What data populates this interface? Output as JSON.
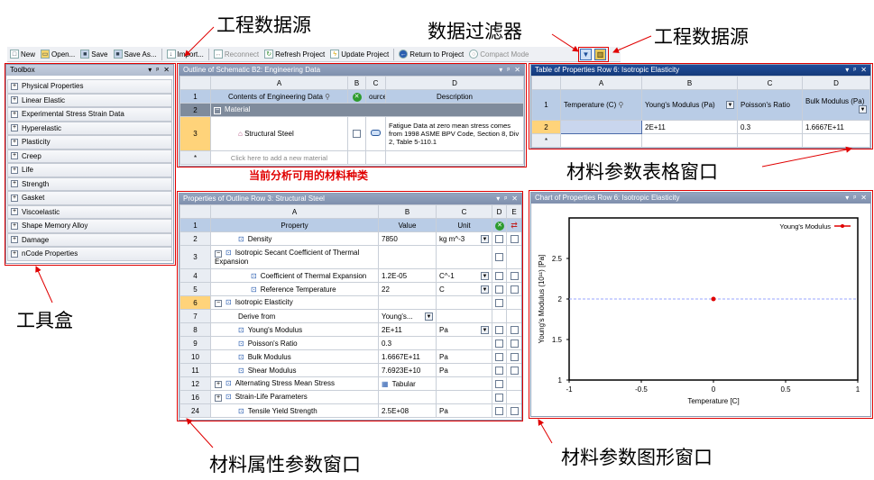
{
  "annotations": {
    "engineering_data_source_1": "工程数据源",
    "data_filter": "数据过滤器",
    "engineering_data_source_2": "工程数据源",
    "toolbox": "工具盒",
    "available_materials": "当前分析可用的材料种类",
    "material_property_table": "材料参数表格窗口",
    "material_property_window": "材料属性参数窗口",
    "material_chart_window": "材料参数图形窗口"
  },
  "toolbar": {
    "new": "New",
    "open": "Open...",
    "save": "Save",
    "save_as": "Save As...",
    "import": "Import...",
    "reconnect": "Reconnect",
    "refresh": "Refresh Project",
    "update": "Update Project",
    "return": "Return to Project",
    "compact": "Compact Mode"
  },
  "toolbox": {
    "title": "Toolbox",
    "items": [
      "Physical Properties",
      "Linear Elastic",
      "Experimental Stress Strain Data",
      "Hyperelastic",
      "Plasticity",
      "Creep",
      "Life",
      "Strength",
      "Gasket",
      "Viscoelastic",
      "Shape Memory Alloy",
      "Damage",
      "nCode Properties"
    ]
  },
  "outline": {
    "title": "Outline of Schematic B2: Engineering Data",
    "cols": [
      "A",
      "B",
      "C",
      "D"
    ],
    "header": {
      "a": "Contents of Engineering Data",
      "c": "ource",
      "d": "Description"
    },
    "group": "Material",
    "material": "Structural Steel",
    "description": "Fatigue Data at zero mean stress comes from 1998 ASME BPV Code, Section 8, Div 2, Table 5-110.1",
    "add_row": "Click here to add a new material",
    "rows": [
      "1",
      "2",
      "3",
      "*"
    ]
  },
  "props": {
    "title": "Properties of Outline Row 3: Structural Steel",
    "cols": [
      "A",
      "B",
      "C",
      "D",
      "E"
    ],
    "header": {
      "property": "Property",
      "value": "Value",
      "unit": "Unit"
    },
    "rows": [
      {
        "n": "1",
        "name": "",
        "value": "",
        "unit": ""
      },
      {
        "n": "2",
        "name": "Density",
        "value": "7850",
        "unit": "kg m^-3"
      },
      {
        "n": "3",
        "name": "Isotropic Secant Coefficient of Thermal Expansion",
        "value": "",
        "unit": ""
      },
      {
        "n": "4",
        "name": "Coefficient of Thermal Expansion",
        "value": "1.2E-05",
        "unit": "C^-1"
      },
      {
        "n": "5",
        "name": "Reference Temperature",
        "value": "22",
        "unit": "C"
      },
      {
        "n": "6",
        "name": "Isotropic Elasticity",
        "value": "",
        "unit": ""
      },
      {
        "n": "7",
        "name": "Derive from",
        "value": "Young's...",
        "unit": ""
      },
      {
        "n": "8",
        "name": "Young's Modulus",
        "value": "2E+11",
        "unit": "Pa"
      },
      {
        "n": "9",
        "name": "Poisson's Ratio",
        "value": "0.3",
        "unit": ""
      },
      {
        "n": "10",
        "name": "Bulk Modulus",
        "value": "1.6667E+11",
        "unit": "Pa"
      },
      {
        "n": "11",
        "name": "Shear Modulus",
        "value": "7.6923E+10",
        "unit": "Pa"
      },
      {
        "n": "12",
        "name": "Alternating Stress Mean Stress",
        "value": "Tabular",
        "unit": ""
      },
      {
        "n": "16",
        "name": "Strain-Life Parameters",
        "value": "",
        "unit": ""
      },
      {
        "n": "24",
        "name": "Tensile Yield Strength",
        "value": "2.5E+08",
        "unit": "Pa"
      }
    ]
  },
  "table": {
    "title": "Table of Properties Row 6: Isotropic Elasticity",
    "cols": [
      "A",
      "B",
      "C",
      "D"
    ],
    "headers": [
      "Temperature (C)",
      "Young's Modulus (Pa)",
      "Poisson's Ratio",
      "Bulk Modulus (Pa)"
    ],
    "row": [
      "",
      "2E+11",
      "0.3",
      "1.6667E+11"
    ],
    "rows": [
      "1",
      "2",
      "*"
    ]
  },
  "chart": {
    "title": "Chart of Properties Row 6: Isotropic Elasticity",
    "ylabel": "Young's Modulus  (10¹¹) [Pa]",
    "xlabel": "Temperature [C]",
    "legend": "Young's Modulus",
    "yticks": [
      "1",
      "1.5",
      "2",
      "2.5"
    ],
    "xticks": [
      "-1",
      "-0.5",
      "0",
      "0.5",
      "1"
    ],
    "series_color": "#e00000"
  },
  "chart_data": {
    "type": "scatter",
    "x": [
      0
    ],
    "series": [
      {
        "name": "Young's Modulus",
        "values": [
          2
        ]
      }
    ],
    "xlabel": "Temperature [C]",
    "ylabel": "Young's Modulus  (10¹¹) [Pa]",
    "xlim": [
      -1,
      1
    ],
    "ylim": [
      1,
      3
    ],
    "legend": "top-right"
  }
}
